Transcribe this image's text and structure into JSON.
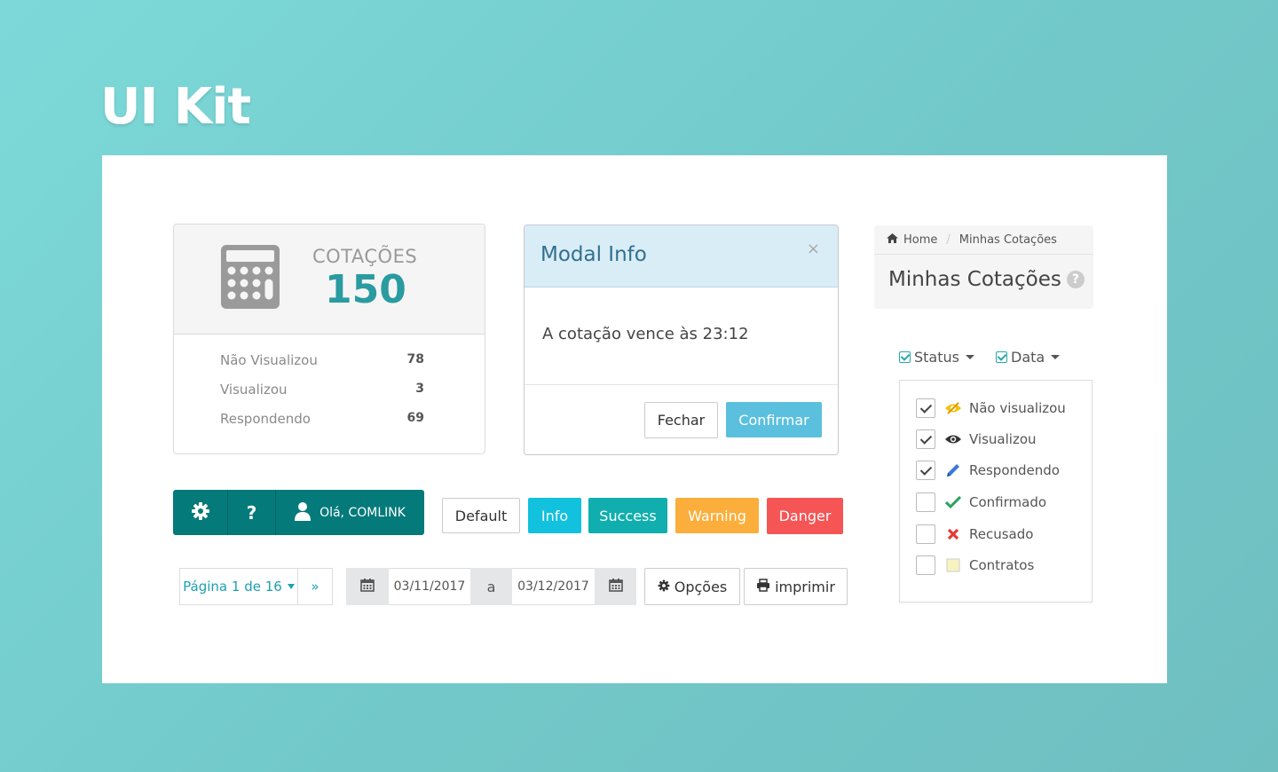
{
  "page": {
    "title": "UI Kit"
  },
  "stats_card": {
    "label": "COTAÇÕES",
    "value": "150",
    "rows": [
      {
        "label": "Não Visualizou",
        "value": "78"
      },
      {
        "label": "Visualizou",
        "value": "3"
      },
      {
        "label": "Respondendo",
        "value": "69"
      }
    ]
  },
  "modal": {
    "title": "Modal Info",
    "close": "×",
    "body": "A cotação vence às 23:12",
    "cancel_label": "Fechar",
    "confirm_label": "Confirmar"
  },
  "breadcrumb": {
    "home": "Home",
    "separator": "/",
    "current": "Minhas Cotações",
    "page_title": "Minhas Cotações",
    "help": "?"
  },
  "filters": {
    "status_label": "Status",
    "date_label": "Data",
    "items": [
      {
        "label": "Não visualizou",
        "checked": true,
        "icon": "eye-slash-icon"
      },
      {
        "label": "Visualizou",
        "checked": true,
        "icon": "eye-icon"
      },
      {
        "label": "Respondendo",
        "checked": true,
        "icon": "pencil-icon"
      },
      {
        "label": "Confirmado",
        "checked": false,
        "icon": "check-icon"
      },
      {
        "label": "Recusado",
        "checked": false,
        "icon": "times-icon"
      },
      {
        "label": "Contratos",
        "checked": false,
        "icon": "square-icon"
      }
    ]
  },
  "toolbar": {
    "help": "?",
    "user_greeting": "Olá, COMLINK"
  },
  "buttons": {
    "default": "Default",
    "info": "Info",
    "success": "Success",
    "warning": "Warning",
    "danger": "Danger"
  },
  "pagination": {
    "label": "Página 1 de 16",
    "next": "»"
  },
  "date_range": {
    "from": "03/11/2017",
    "separator": "a",
    "to": "03/12/2017"
  },
  "actions": {
    "options": "Opções",
    "print": "imprimir"
  },
  "colors": {
    "teal": "#057a7a",
    "info": "#11c1de",
    "success": "#10aeae",
    "warning": "#fbae3b",
    "danger": "#f55555"
  }
}
